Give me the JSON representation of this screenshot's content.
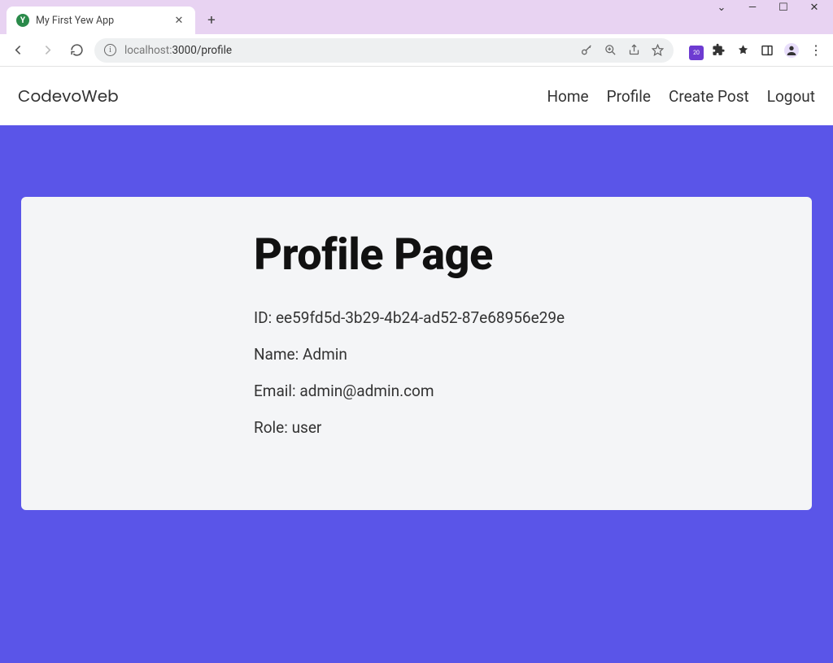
{
  "browser": {
    "tab_title": "My First Yew App",
    "tab_favicon_letter": "Y",
    "url_host": "localhost:",
    "url_path": "3000/profile"
  },
  "app": {
    "brand": "CodevoWeb",
    "nav": {
      "home": "Home",
      "profile": "Profile",
      "create_post": "Create Post",
      "logout": "Logout"
    }
  },
  "page": {
    "title": "Profile Page",
    "details": {
      "id_label": "ID:",
      "id_value": "ee59fd5d-3b29-4b24-ad52-87e68956e29e",
      "name_label": "Name:",
      "name_value": "Admin",
      "email_label": "Email:",
      "email_value": "admin@admin.com",
      "role_label": "Role:",
      "role_value": "user"
    }
  },
  "ext_badge": "20"
}
